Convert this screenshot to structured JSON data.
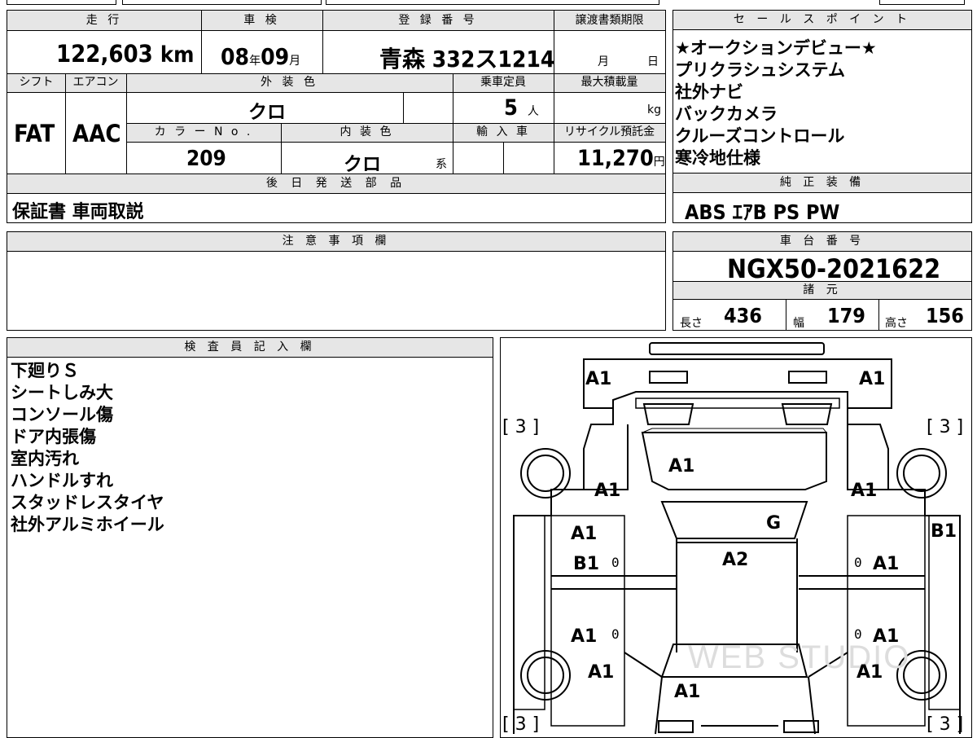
{
  "top_sheet": {
    "mileage_label": "走 行",
    "mileage_value": "122,603",
    "mileage_unit": "km",
    "inspection_label": "車 検",
    "inspection_year": "08",
    "inspection_year_unit": "年",
    "inspection_month": "09",
    "inspection_month_unit": "月",
    "registration_label": "登 録 番 号",
    "registration_value": "青森 332ス1214",
    "transfer_deadline_label": "譲渡書類期限",
    "transfer_month_unit": "月",
    "transfer_day_unit": "日",
    "shift_label": "シフト",
    "shift_value": "FAT",
    "ac_label": "エアコン",
    "ac_value": "AAC",
    "exterior_color_label": "外 装 色",
    "exterior_color_value": "クロ",
    "capacity_label": "乗車定員",
    "capacity_value": "5",
    "capacity_unit": "人",
    "max_load_label": "最大積載量",
    "max_load_unit": "kg",
    "color_no_label": "カ ラ ー N o .",
    "color_no_value": "209",
    "interior_color_label": "内 装 色",
    "interior_color_value": "クロ",
    "interior_color_suffix": "系",
    "import_label": "輸 入 車",
    "recycle_label": "リサイクル預託金",
    "recycle_value": "11,270",
    "recycle_unit": "円",
    "later_parts_label": "後 日 発 送 部 品",
    "later_parts_value": "保証書 車両取説"
  },
  "sales_points": {
    "header": "セ ー ル ス ポ イ ン ト",
    "items": [
      "★オークションデビュー★",
      "プリクラシュシステム",
      "社外ナビ",
      "バックカメラ",
      "クルーズコントロール",
      "寒冷地仕様"
    ]
  },
  "standard_equipment": {
    "header": "純 正 装 備",
    "value": "ABS ｴｱB PS PW"
  },
  "notes": {
    "header": "注 意 事 項 欄",
    "value": ""
  },
  "chassis": {
    "header": "車 台 番 号",
    "value": "NGX50-2021622",
    "specs_header": "諸 元",
    "length_label": "長さ",
    "length_value": "436",
    "width_label": "幅",
    "width_value": "179",
    "height_label": "高さ",
    "height_value": "156"
  },
  "inspector": {
    "header": "検 査 員 記 入 欄",
    "lines": [
      "下廻りＳ",
      "シートしみ大",
      "コンソール傷",
      "ドア内張傷",
      "室内汚れ",
      "ハンドルすれ",
      "スタッドレスタイヤ",
      "社外アルミホイール"
    ]
  },
  "diagram": {
    "watermark": "WEB STUDIO",
    "marks": {
      "bumper_front_left": "A1",
      "bumper_front_right": "A1",
      "tire_fl": "[ 3 ]",
      "tire_fr": "[ 3 ]",
      "tire_rl": "[ 3 ]",
      "tire_rr": "[ 3 ]",
      "hood": "A1",
      "fender_fl": "A1",
      "fender_fr": "A1",
      "windshield": "G",
      "roof": "A2",
      "pillar_right": "B1",
      "door_fl_a": "A1",
      "door_fl_b": "B1",
      "door_fr": "A1",
      "door_rl": "A1",
      "door_rr": "A1",
      "quarter_rl": "A1",
      "quarter_rr": "A1",
      "trunk": "A1",
      "zero": "0"
    }
  }
}
